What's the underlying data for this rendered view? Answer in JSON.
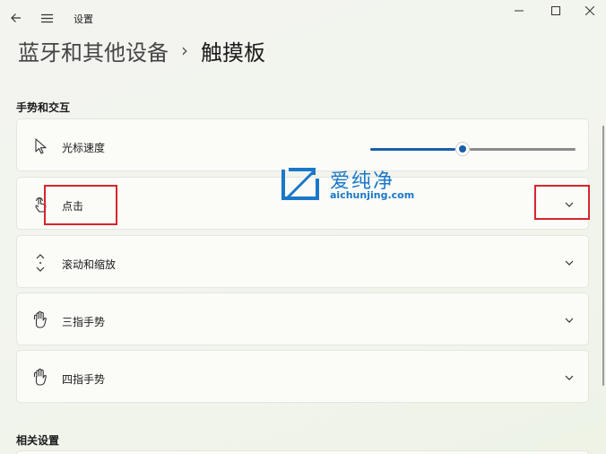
{
  "window": {
    "title": "设置",
    "back_icon": "arrow-left-icon",
    "menu_icon": "hamburger-icon",
    "controls": [
      "minimize-icon",
      "maximize-icon",
      "close-icon"
    ]
  },
  "breadcrumb": {
    "parent": "蓝牙和其他设备",
    "separator": "›",
    "current": "触摸板"
  },
  "sections": {
    "gestures": "手势和交互",
    "related": "相关设置"
  },
  "cards": {
    "cursor_speed": {
      "label": "光标速度",
      "icon": "cursor-icon",
      "slider_value": 0.45
    },
    "tap": {
      "label": "点击",
      "icon": "tap-hand-icon"
    },
    "scroll_zoom": {
      "label": "滚动和缩放",
      "icon": "scroll-arrows-icon"
    },
    "three_finger": {
      "label": "三指手势",
      "icon": "three-finger-hand-icon"
    },
    "four_finger": {
      "label": "四指手势",
      "icon": "four-finger-hand-icon"
    }
  },
  "watermark": {
    "title": "爱纯净",
    "url": "aichunjing.com"
  },
  "colors": {
    "accent": "#1a5fa8",
    "annotation": "#d6262e",
    "watermark": "#1a78c8"
  }
}
